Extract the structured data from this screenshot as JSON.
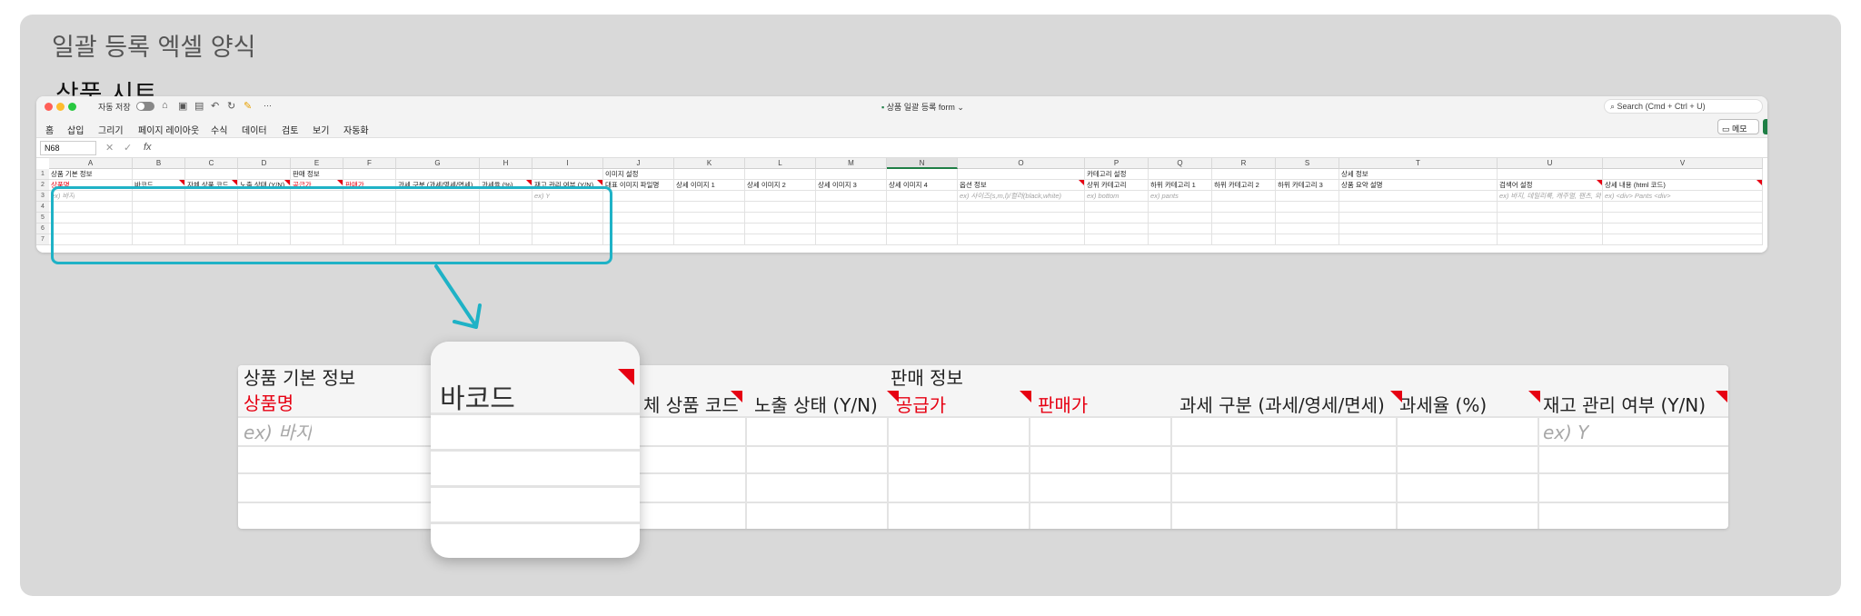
{
  "page": {
    "title": "일괄 등록 엑셀 양식",
    "sheet_title": "상품 시트"
  },
  "window": {
    "autosave_label": "자동 저장",
    "doc_title": "상품 일괄 등록 form",
    "search_placeholder": "Search (Cmd + Ctrl + U)",
    "memo_label": "메모",
    "more_label": "···",
    "traffic": {
      "close": "#ff5f57",
      "min": "#febc2e",
      "max": "#28c840"
    }
  },
  "menu": [
    "홈",
    "삽입",
    "그리기",
    "페이지 레이아웃",
    "수식",
    "데이터",
    "검토",
    "보기",
    "자동화"
  ],
  "formula_bar": {
    "name_box": "N68",
    "fx": "fx",
    "cancel": "✕",
    "confirm": "✓"
  },
  "columns": [
    "A",
    "B",
    "C",
    "D",
    "E",
    "F",
    "G",
    "H",
    "I",
    "J",
    "K",
    "L",
    "M",
    "N",
    "O",
    "P",
    "Q",
    "R",
    "S",
    "T",
    "U",
    "V"
  ],
  "rows": [
    "1",
    "2",
    "3",
    "4",
    "5",
    "6",
    "7"
  ],
  "row1": {
    "A": "상품 기본 정보",
    "E": "판매 정보",
    "J": "이미지 설정",
    "P": "카테고리 설정",
    "T": "상세 정보"
  },
  "row2": {
    "A": "상품명",
    "B": "바코드",
    "C": "자체 상품 코드",
    "D": "노출 상태 (Y/N)",
    "E": "공급가",
    "F": "판매가",
    "G": "과세 구분 (과세/영세/면세)",
    "H": "과세율 (%)",
    "I": "재고 관리 여부 (Y/N)",
    "J": "대표 이미지 파일명",
    "K": "상세 이미지 1",
    "L": "상세 이미지 2",
    "M": "상세 이미지 3",
    "N": "상세 이미지 4",
    "O": "옵션 정보",
    "P": "상위 카테고리",
    "Q": "하위 카테고리 1",
    "R": "하위 카테고리 2",
    "S": "하위 카테고리 3",
    "T": "상품 요약 설명",
    "U": "검색어 설정",
    "V": "상세 내용 (html 코드)"
  },
  "row3": {
    "A": "ex) 바지",
    "I": "ex) Y",
    "O": "ex) 사이즈(s,m,l)/컬러(black,white)",
    "P": "ex) bottom",
    "Q": "ex) pants",
    "U": "ex) 바지, 데일리룩, 캐주얼, 팬츠, 와이드팬츠",
    "V": "ex) <div> Pants <div>"
  },
  "zoom": {
    "r1_a": "상품 기본 정보",
    "r1_e": "판매 정보",
    "a": "상품명",
    "c": "체 상품 코드",
    "d": "노출 상태 (Y/N)",
    "e": "공급가",
    "f": "판매가",
    "g": "과세 구분 (과세/영세/면세)",
    "h": "과세율 (%)",
    "i": "재고 관리 여부 (Y/N)",
    "hint_a": "ex) 바지",
    "hint_i": "ex) Y"
  },
  "popup": {
    "label": "바코드"
  },
  "colors": {
    "accent": "#1fb2c6",
    "required": "#e60012",
    "excel_green": "#1e7e45"
  }
}
